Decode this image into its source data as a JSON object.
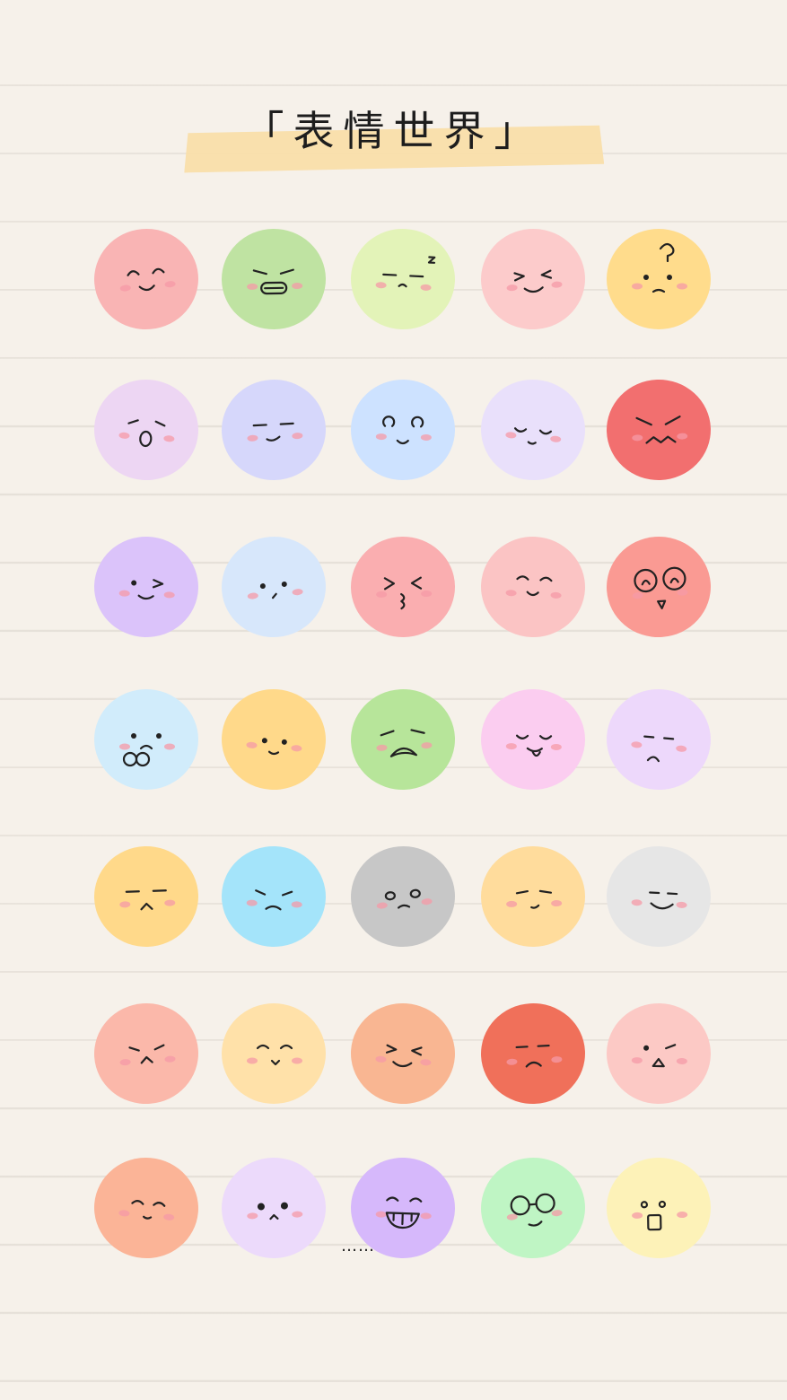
{
  "title": "「表情世界」",
  "trailing_dots": "……",
  "emojis": [
    {
      "color": "#f9b4b4"
    },
    {
      "color": "#bfe3a2"
    },
    {
      "color": "#e3f3b8"
    },
    {
      "color": "#fccbcb"
    },
    {
      "color": "#ffdc8c"
    },
    {
      "color": "#edd6f3"
    },
    {
      "color": "#d6d7fb"
    },
    {
      "color": "#cde2ff"
    },
    {
      "color": "#e9e0fb"
    },
    {
      "color": "#f26f6f"
    },
    {
      "color": "#dbc3fa"
    },
    {
      "color": "#d7e7fb"
    },
    {
      "color": "#faaeb0"
    },
    {
      "color": "#fbc4c4"
    },
    {
      "color": "#fa9a93"
    },
    {
      "color": "#d1ecfb"
    },
    {
      "color": "#ffd98a"
    },
    {
      "color": "#b7e59a"
    },
    {
      "color": "#fbcdf0"
    },
    {
      "color": "#edd8fb"
    },
    {
      "color": "#ffd98a"
    },
    {
      "color": "#a4e4fa"
    },
    {
      "color": "#c7c7c7"
    },
    {
      "color": "#ffdc9c"
    },
    {
      "color": "#e6e6e6"
    },
    {
      "color": "#fbb8aa"
    },
    {
      "color": "#ffe1a9"
    },
    {
      "color": "#f9b692"
    },
    {
      "color": "#f0705a"
    },
    {
      "color": "#fcc9c5"
    },
    {
      "color": "#fbb497"
    },
    {
      "color": "#ecdafb"
    },
    {
      "color": "#d6b8fb"
    },
    {
      "color": "#bff5c4"
    },
    {
      "color": "#fdf2b8"
    }
  ]
}
